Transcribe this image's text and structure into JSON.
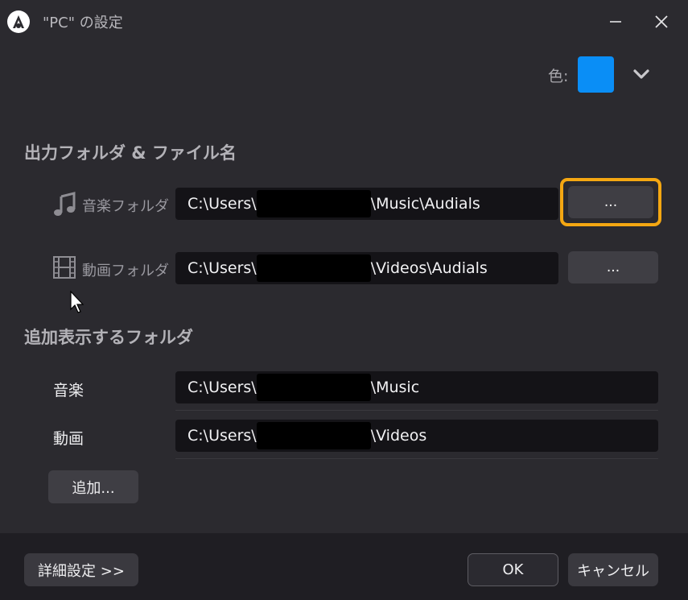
{
  "window": {
    "title": "\"PC\" の設定",
    "logo_icon": "audials-logo-icon",
    "minimize_icon": "minimize-icon",
    "close_icon": "close-icon"
  },
  "color_picker": {
    "label": "色:",
    "value": "#0a8ef6",
    "dropdown_icon": "chevron-down-icon"
  },
  "output_section": {
    "title": "出力フォルダ & ファイル名",
    "rows": [
      {
        "icon": "music-note-icon",
        "label": "音楽フォルダ",
        "path_prefix": "C:\\Users\\",
        "path_suffix": "\\Music\\Audials",
        "button": "...",
        "focused": true
      },
      {
        "icon": "film-icon",
        "label": "動画フォルダ",
        "path_prefix": "C:\\Users\\",
        "path_suffix": "\\Videos\\Audials",
        "button": "..."
      }
    ]
  },
  "extra_section": {
    "title": "追加表示するフォルダ",
    "rows": [
      {
        "label": "音楽",
        "path_prefix": "C:\\Users\\",
        "path_suffix": "\\Music"
      },
      {
        "label": "動画",
        "path_prefix": "C:\\Users\\",
        "path_suffix": "\\Videos"
      }
    ],
    "add_button": "追加..."
  },
  "footer": {
    "advanced_button": "詳細設定 >>",
    "ok_button": "OK",
    "cancel_button": "キャンセル"
  },
  "colors": {
    "focus_ring": "#f4a712",
    "background": "#2b2a2f",
    "footer_background": "#1f1e23"
  }
}
